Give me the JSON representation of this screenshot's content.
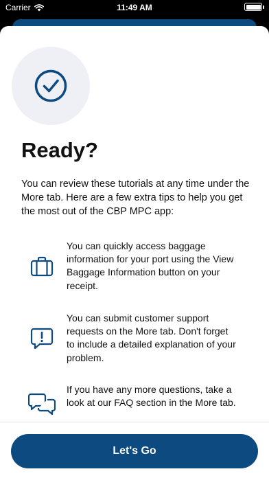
{
  "status_bar": {
    "carrier": "Carrier",
    "time": "11:49 AM"
  },
  "content": {
    "title": "Ready?",
    "intro": "You can review these tutorials at any time under the More tab. Here are a few extra tips to help you get the most out of the CBP MPC app:",
    "tips": [
      {
        "icon": "briefcase-icon",
        "text": "You can quickly access baggage information for your port using the View Baggage Information button on your receipt."
      },
      {
        "icon": "chat-alert-icon",
        "text": "You can submit customer support requests on the More tab. Don't forget to include a detailed explanation of your problem."
      },
      {
        "icon": "chat-bubbles-icon",
        "text": "If you have any more questions, take a look at our FAQ section in the More tab."
      }
    ]
  },
  "footer": {
    "button_label": "Let's Go"
  },
  "colors": {
    "brand": "#0c4a80",
    "circle_bg": "#eef0f6"
  }
}
